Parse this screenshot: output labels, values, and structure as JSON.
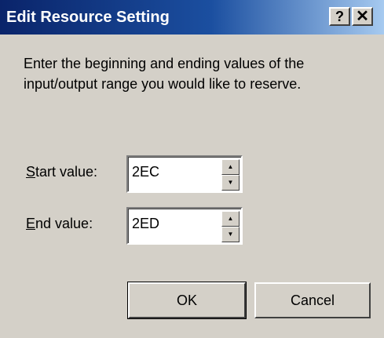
{
  "window": {
    "title": "Edit Resource Setting",
    "help_label": "?",
    "close_label": "✕"
  },
  "message": "Enter the beginning and ending values of the input/output range you would like to reserve.",
  "start": {
    "label_mnemonic": "S",
    "label_rest": "tart value:",
    "value": "2EC"
  },
  "end": {
    "label_mnemonic": "E",
    "label_rest": "nd value:",
    "value": "2ED"
  },
  "buttons": {
    "ok": "OK",
    "cancel": "Cancel"
  },
  "icons": {
    "spin_up": "▲",
    "spin_down": "▼"
  }
}
